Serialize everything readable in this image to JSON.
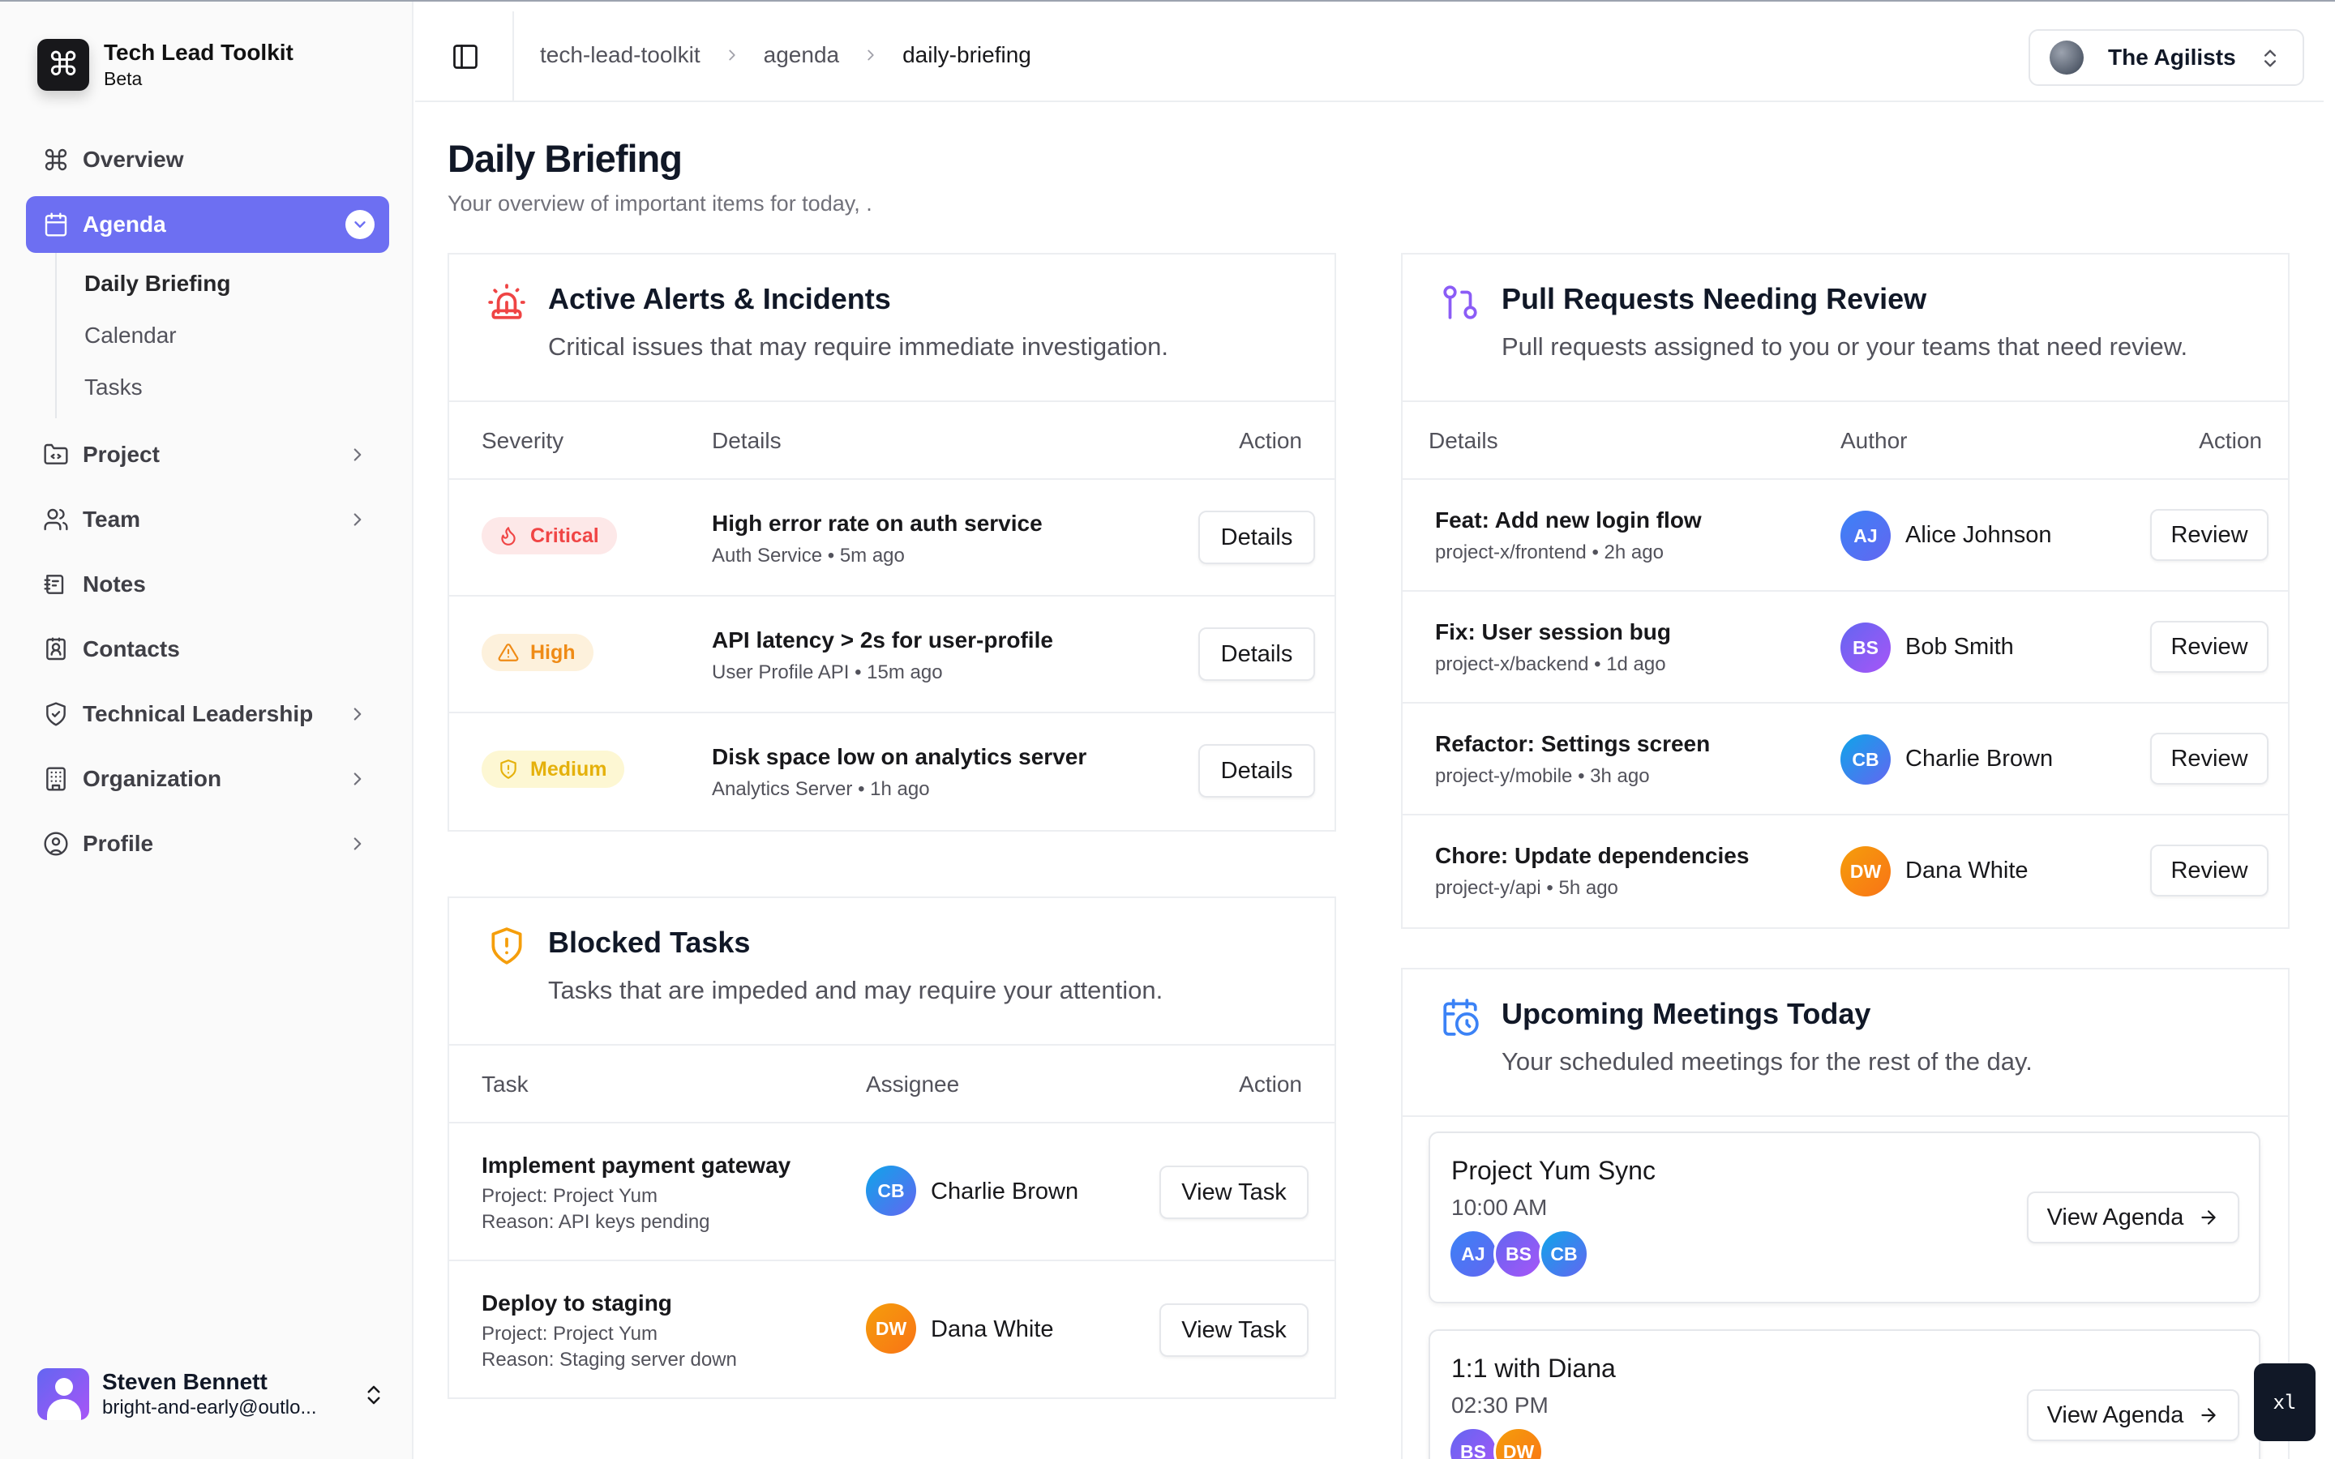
{
  "app": {
    "title": "Tech Lead Toolkit",
    "subtitle": "Beta"
  },
  "sidebar": {
    "items": [
      {
        "label": "Overview",
        "icon": "command-icon"
      },
      {
        "label": "Agenda",
        "icon": "calendar-icon",
        "active": true,
        "children": [
          {
            "label": "Daily Briefing",
            "current": true
          },
          {
            "label": "Calendar"
          },
          {
            "label": "Tasks"
          }
        ]
      },
      {
        "label": "Project",
        "icon": "folder-icon"
      },
      {
        "label": "Team",
        "icon": "users-icon"
      },
      {
        "label": "Notes",
        "icon": "notebook-icon"
      },
      {
        "label": "Contacts",
        "icon": "contact-card-icon"
      },
      {
        "label": "Technical Leadership",
        "icon": "shield-check-icon"
      },
      {
        "label": "Organization",
        "icon": "building-icon"
      },
      {
        "label": "Profile",
        "icon": "user-circle-icon"
      }
    ]
  },
  "user": {
    "name": "Steven Bennett",
    "email": "bright-and-early@outlo..."
  },
  "header": {
    "breadcrumb": [
      "tech-lead-toolkit",
      "agenda",
      "daily-briefing"
    ],
    "team": "The Agilists"
  },
  "page": {
    "title": "Daily Briefing",
    "subtitle": "Your overview of important items for today, ."
  },
  "alerts": {
    "title": "Active Alerts & Incidents",
    "description": "Critical issues that may require immediate investigation.",
    "columns": [
      "Severity",
      "Details",
      "Action"
    ],
    "rows": [
      {
        "severity": "Critical",
        "title": "High error rate on auth service",
        "service": "Auth Service",
        "time": "5m ago",
        "action": "Details"
      },
      {
        "severity": "High",
        "title": "API latency > 2s for user-profile",
        "service": "User Profile API",
        "time": "15m ago",
        "action": "Details"
      },
      {
        "severity": "Medium",
        "title": "Disk space low on analytics server",
        "service": "Analytics Server",
        "time": "1h ago",
        "action": "Details"
      }
    ]
  },
  "blocked": {
    "title": "Blocked Tasks",
    "description": "Tasks that are impeded and may require your attention.",
    "columns": [
      "Task",
      "Assignee",
      "Action"
    ],
    "rows": [
      {
        "task": "Implement payment gateway",
        "project": "Project: Project Yum",
        "reason": "Reason: API keys pending",
        "initials": "CB",
        "assignee": "Charlie Brown",
        "action": "View Task"
      },
      {
        "task": "Deploy to staging",
        "project": "Project: Project Yum",
        "reason": "Reason: Staging server down",
        "initials": "DW",
        "assignee": "Dana White",
        "action": "View Task"
      }
    ]
  },
  "prs": {
    "title": "Pull Requests Needing Review",
    "description": "Pull requests assigned to you or your teams that need review.",
    "columns": [
      "Details",
      "Author",
      "Action"
    ],
    "rows": [
      {
        "title": "Feat: Add new login flow",
        "repo": "project-x/frontend",
        "time": "2h ago",
        "initials": "AJ",
        "author": "Alice Johnson",
        "action": "Review"
      },
      {
        "title": "Fix: User session bug",
        "repo": "project-x/backend",
        "time": "1d ago",
        "initials": "BS",
        "author": "Bob Smith",
        "action": "Review"
      },
      {
        "title": "Refactor: Settings screen",
        "repo": "project-y/mobile",
        "time": "3h ago",
        "initials": "CB",
        "author": "Charlie Brown",
        "action": "Review"
      },
      {
        "title": "Chore: Update dependencies",
        "repo": "project-y/api",
        "time": "5h ago",
        "initials": "DW",
        "author": "Dana White",
        "action": "Review"
      }
    ]
  },
  "meetings": {
    "title": "Upcoming Meetings Today",
    "description": "Your scheduled meetings for the rest of the day.",
    "items": [
      {
        "title": "Project Yum Sync",
        "time": "10:00 AM",
        "attendees": [
          "AJ",
          "BS",
          "CB"
        ],
        "action": "View Agenda"
      },
      {
        "title": "1:1 with Diana",
        "time": "02:30 PM",
        "attendees": [
          "BS",
          "DW"
        ],
        "action": "View Agenda"
      }
    ]
  },
  "separator": "•",
  "breakpoint_badge": "xl",
  "colors": {
    "accent": "#6d6ff2",
    "critical": "#f04545",
    "high": "#ef8b16",
    "medium": "#e5b10c"
  }
}
